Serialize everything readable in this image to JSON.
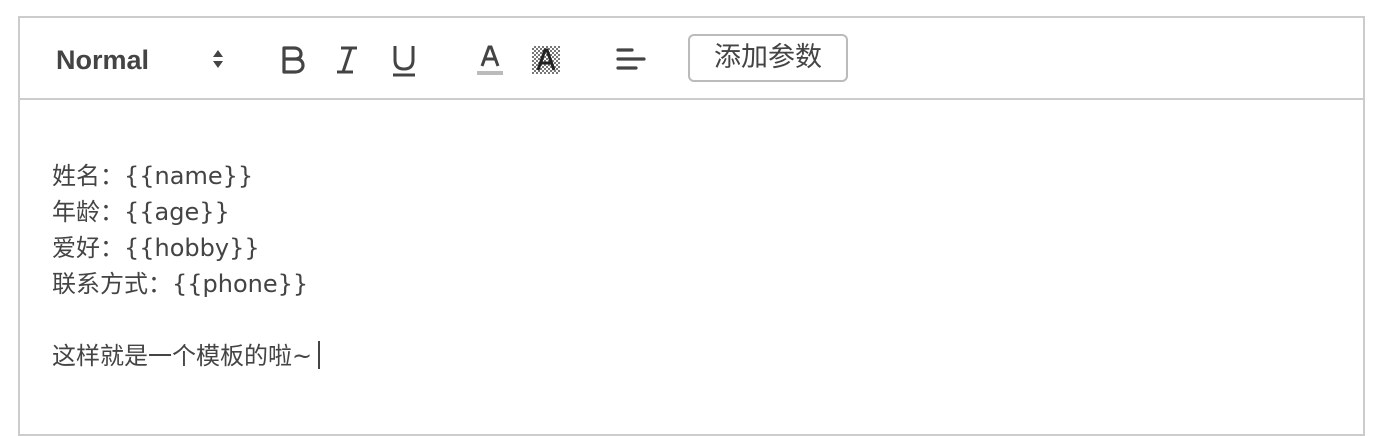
{
  "toolbar": {
    "header_select": {
      "selected": "Normal"
    },
    "buttons": [
      {
        "name": "bold",
        "icon": "bold-icon"
      },
      {
        "name": "italic",
        "icon": "italic-icon"
      },
      {
        "name": "underline",
        "icon": "underline-icon"
      },
      {
        "name": "text-color",
        "icon": "text-color-icon"
      },
      {
        "name": "background-color",
        "icon": "background-color-icon"
      },
      {
        "name": "align",
        "icon": "align-left-icon"
      }
    ],
    "add_param_label": "添加参数"
  },
  "editor": {
    "lines": [
      "姓名：{{name}}",
      "年龄：{{age}}",
      "爱好：{{hobby}}",
      "联系方式：{{phone}}",
      "",
      "这样就是一个模板的啦~"
    ]
  },
  "colors": {
    "border": "#cccccc",
    "text": "#444444"
  }
}
